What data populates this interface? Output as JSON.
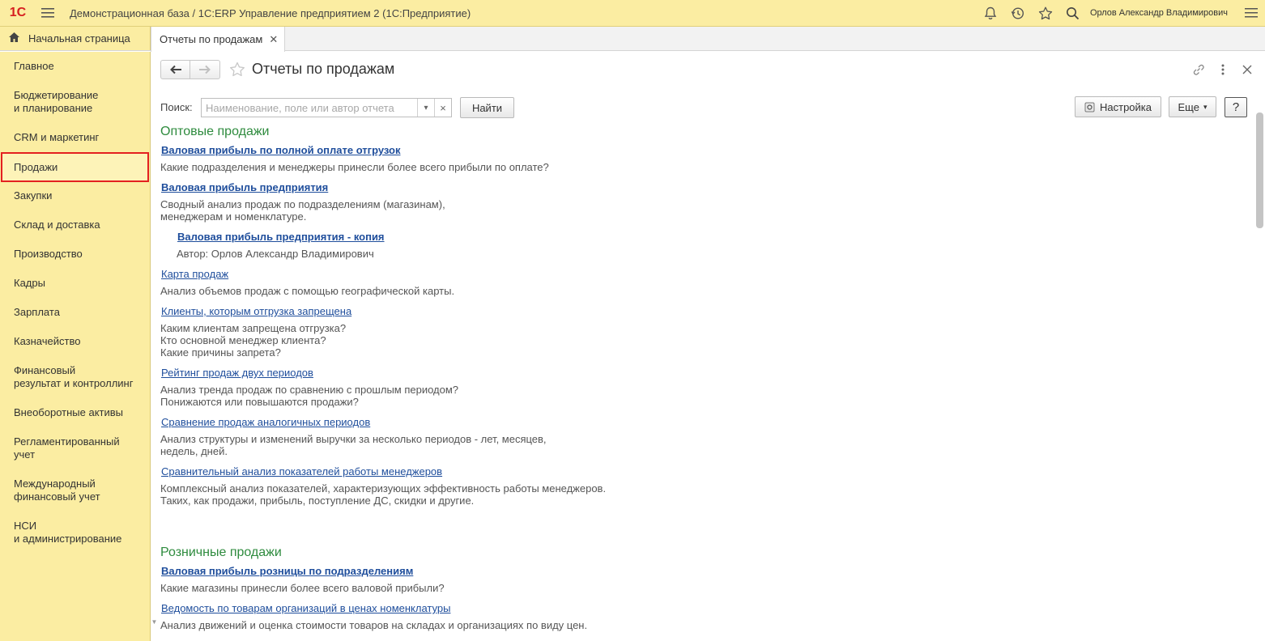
{
  "app": {
    "logo": "1С",
    "title": "Демонстрационная база / 1С:ERP Управление предприятием 2  (1С:Предприятие)",
    "user": "Орлов Александр Владимирович"
  },
  "tabs": {
    "home": "Начальная страница",
    "current": "Отчеты по продажам"
  },
  "sidebar": {
    "items": [
      {
        "label": "Главное"
      },
      {
        "label": "Бюджетирование\nи планирование"
      },
      {
        "label": "CRM и маркетинг"
      },
      {
        "label": "Продажи"
      },
      {
        "label": "Закупки"
      },
      {
        "label": "Склад и доставка"
      },
      {
        "label": "Производство"
      },
      {
        "label": "Кадры"
      },
      {
        "label": "Зарплата"
      },
      {
        "label": "Казначейство"
      },
      {
        "label": "Финансовый\nрезультат и контроллинг"
      },
      {
        "label": "Внеоборотные активы"
      },
      {
        "label": "Регламентированный\nучет"
      },
      {
        "label": "Международный\nфинансовый учет"
      },
      {
        "label": "НСИ\nи администрирование"
      }
    ],
    "active": "Продажи"
  },
  "page": {
    "title": "Отчеты по продажам",
    "search_label": "Поиск:",
    "search_placeholder": "Наименование, поле или автор отчета",
    "search_clear": "×",
    "find_button": "Найти",
    "settings_button": "Настройка",
    "more_button": "Еще",
    "help_button": "?"
  },
  "groups": [
    {
      "title": "Оптовые продажи",
      "reports": [
        {
          "title": "Валовая прибыль по полной оплате отгрузок",
          "bold": true,
          "description": "Какие подразделения и менеджеры принесли более всего прибыли по оплате?"
        },
        {
          "title": "Валовая прибыль предприятия",
          "bold": true,
          "description": "Сводный анализ продаж по подразделениям (магазинам),\nменеджерам и номенклатуре."
        },
        {
          "title": "Валовая прибыль предприятия - копия",
          "bold": true,
          "description": "Автор: Орлов Александр Владимирович"
        },
        {
          "title": "Карта продаж",
          "bold": false,
          "description": "Анализ объемов продаж с помощью географической карты."
        },
        {
          "title": "Клиенты, которым отгрузка запрещена",
          "bold": false,
          "description": "Каким клиентам запрещена отгрузка?\nКто основной менеджер клиента?\nКакие причины запрета?"
        },
        {
          "title": "Рейтинг продаж двух периодов",
          "bold": false,
          "description": "Анализ тренда продаж по сравнению с прошлым периодом?\nПонижаются или повышаются продажи?"
        },
        {
          "title": "Сравнение продаж аналогичных периодов",
          "bold": false,
          "description": "Анализ структуры и изменений выручки за несколько периодов - лет, месяцев,\nнедель, дней."
        },
        {
          "title": "Сравнительный анализ показателей работы менеджеров",
          "bold": false,
          "description": "Комплексный анализ показателей, характеризующих эффективность работы менеджеров.\nТаких, как продажи, прибыль, поступление ДС, скидки и другие."
        }
      ]
    },
    {
      "title": "Розничные продажи",
      "reports": [
        {
          "title": "Валовая прибыль розницы по подразделениям",
          "bold": true,
          "description": "Какие магазины принесли более всего валовой прибыли?"
        },
        {
          "title": "Ведомость по товарам организаций в ценах номенклатуры",
          "bold": false,
          "description": "Анализ движений и оценка стоимости товаров на складах и организациях по виду цен."
        }
      ]
    }
  ],
  "icons": {
    "menu": "hamburger-icon",
    "notifications": "bell-icon",
    "history": "history-icon",
    "favorites": "star-icon",
    "search": "search-icon",
    "settings": "settings-icon",
    "home": "home-icon",
    "link": "link-icon",
    "more": "more-vertical-icon",
    "close": "close-icon"
  },
  "colors": {
    "sidebar_bg": "#fbeda2",
    "group_title": "#2e8b3e",
    "link": "#1f4e9c",
    "active_border": "#e32020"
  }
}
